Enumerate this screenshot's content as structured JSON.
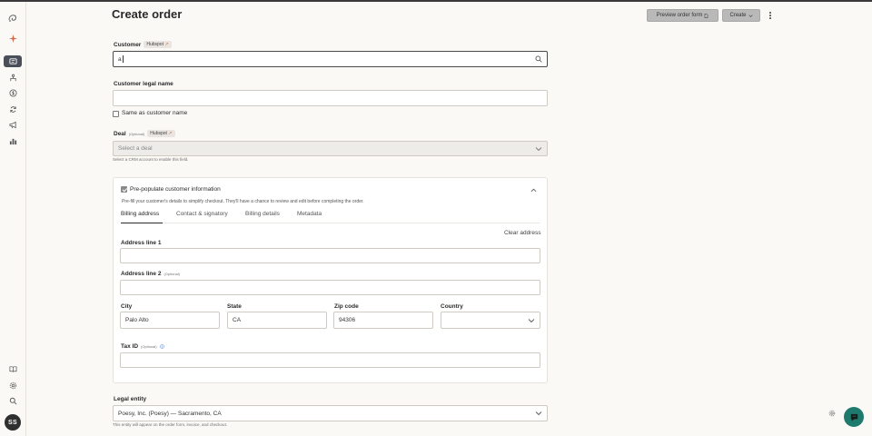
{
  "page": {
    "title": "Create order"
  },
  "header": {
    "preview_label": "Preview order form",
    "create_label": "Create"
  },
  "sidebar": {
    "items": [
      {
        "name": "logo-icon"
      },
      {
        "name": "sparkle-icon"
      },
      {
        "name": "orders-icon",
        "active": true
      },
      {
        "name": "team-icon"
      },
      {
        "name": "dollar-icon"
      },
      {
        "name": "refresh-icon"
      },
      {
        "name": "megaphone-icon"
      },
      {
        "name": "bar-chart-icon"
      }
    ],
    "bottom": [
      {
        "name": "book-icon"
      },
      {
        "name": "settings-icon"
      },
      {
        "name": "search-icon"
      }
    ],
    "avatar_initials": "SS"
  },
  "customer": {
    "label": "Customer",
    "badge": "Hubspot",
    "value": "a"
  },
  "legal_name": {
    "label": "Customer legal name",
    "value": "",
    "same_as_label": "Same as customer name",
    "same_as_checked": false
  },
  "deal": {
    "label": "Deal",
    "optional": "(Optional)",
    "badge": "Hubspot",
    "placeholder": "Select a deal",
    "help": "Select a CRM account to enable this field."
  },
  "prepopulate": {
    "checked": true,
    "label": "Pre-populate customer information",
    "description": "Pre-fill your customer's details to simplify checkout. They'll have a chance to review and edit before completing the order.",
    "tabs": [
      "Billing address",
      "Contact & signatory",
      "Billing details",
      "Metadata"
    ],
    "active_tab": "Billing address",
    "clear_label": "Clear address",
    "address1_label": "Address line 1",
    "address1_value": "",
    "address2_label": "Address line 2",
    "address2_optional": "(Optional)",
    "address2_value": "",
    "city_label": "City",
    "city_value": "Palo Alto",
    "state_label": "State",
    "state_value": "CA",
    "zip_label": "Zip code",
    "zip_value": "94306",
    "country_label": "Country",
    "country_value": "",
    "tax_label": "Tax ID",
    "tax_optional": "(Optional)",
    "tax_value": ""
  },
  "legal_entity": {
    "label": "Legal entity",
    "value": "Poesy, Inc. (Poesy) — Sacramento, CA",
    "help": "This entity will appear on the order form, invoice, and checkout."
  },
  "colors": {
    "background": "#faf9f6",
    "button": "#b9b9b9",
    "chat": "#1f7a6e",
    "sidebar_active": "#4a4f5a"
  }
}
